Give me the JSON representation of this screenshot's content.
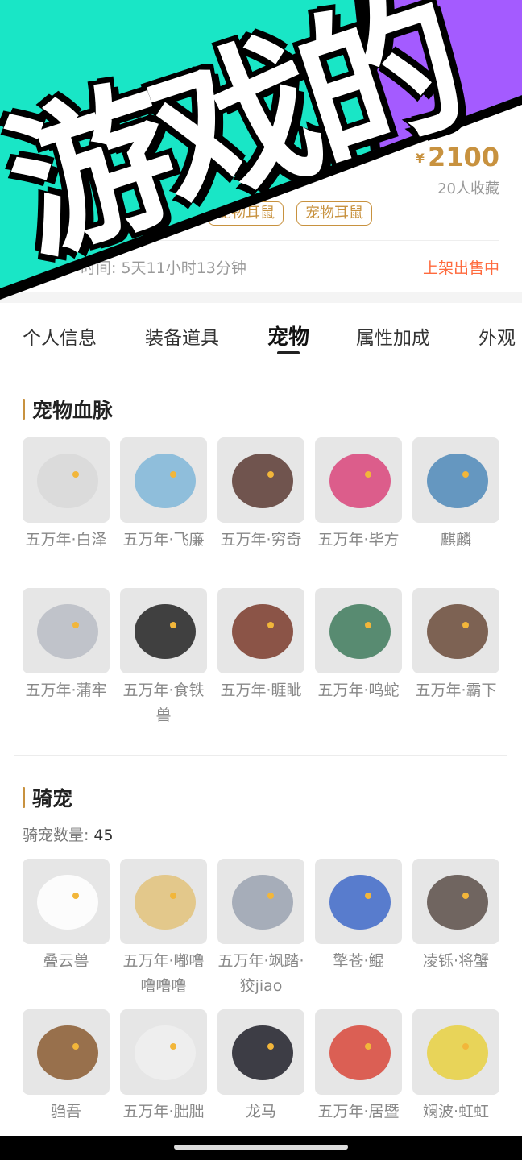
{
  "listing": {
    "yen": "¥",
    "price": "2100",
    "favorites": "20人收藏",
    "tags": [
      "宠物耳鼠",
      "宠物耳鼠"
    ],
    "remaining": "时间: 5天11小时13分钟",
    "status": "上架出售中"
  },
  "banner": {
    "text": "游戏的",
    "colors": {
      "teal": "#19e6c6",
      "purple": "#a45bff",
      "black": "#000000"
    }
  },
  "tabs": {
    "items": [
      "个人信息",
      "装备道具",
      "宠物",
      "属性加成",
      "外观"
    ],
    "active": "宠物"
  },
  "bloodline": {
    "title": "宠物血脉",
    "pets": [
      {
        "name": "五万年·白泽",
        "icon": "white-cat-pet",
        "color": "#d8d8d8"
      },
      {
        "name": "五万年·飞廉",
        "icon": "ice-bird-pet",
        "color": "#7fb6d8"
      },
      {
        "name": "五万年·穷奇",
        "icon": "dark-beast-pet",
        "color": "#5a3a32"
      },
      {
        "name": "五万年·毕方",
        "icon": "colorful-bird-pet",
        "color": "#d9447a"
      },
      {
        "name": "麒麟",
        "icon": "blue-dragon-pet",
        "color": "#4d88b8"
      },
      {
        "name": "五万年·蒲牢",
        "icon": "silver-dragon-pet",
        "color": "#b8bcc4"
      },
      {
        "name": "五万年·食铁兽",
        "icon": "panda-pet",
        "color": "#222222"
      },
      {
        "name": "五万年·睚眦",
        "icon": "red-dragon-pet",
        "color": "#7a3a2a"
      },
      {
        "name": "五万年·鸣蛇",
        "icon": "green-serpent-pet",
        "color": "#3e7a5c"
      },
      {
        "name": "五万年·霸下",
        "icon": "brown-dragon-pet",
        "color": "#6a4a38"
      }
    ]
  },
  "mounts": {
    "title": "骑宠",
    "count_label": "骑宠数量:",
    "count": "45",
    "items": [
      {
        "name": "叠云兽",
        "icon": "cloud-beast-mount",
        "color": "#ffffff"
      },
      {
        "name": "五万年·嘟噜噜噜噜",
        "icon": "golden-hair-mount",
        "color": "#e2c27a"
      },
      {
        "name": "五万年·飒踏·狡jiao",
        "icon": "silver-wolf-mount",
        "color": "#9aa2b0"
      },
      {
        "name": "擎苍·鲲",
        "icon": "blue-whale-mount",
        "color": "#3e68c8"
      },
      {
        "name": "凌铄·将蟹",
        "icon": "crab-mount",
        "color": "#5a4e48"
      },
      {
        "name": "驺吾",
        "icon": "lion-mount",
        "color": "#8a5a30"
      },
      {
        "name": "五万年·朏朏",
        "icon": "white-cat-mount",
        "color": "#eeeeee"
      },
      {
        "name": "龙马",
        "icon": "black-dragon-mount",
        "color": "#1e1e28"
      },
      {
        "name": "五万年·居暨",
        "icon": "red-creature-mount",
        "color": "#d8463a"
      },
      {
        "name": "斓波·虹虹",
        "icon": "rainbow-bird-mount",
        "color": "#e8d040"
      }
    ]
  }
}
